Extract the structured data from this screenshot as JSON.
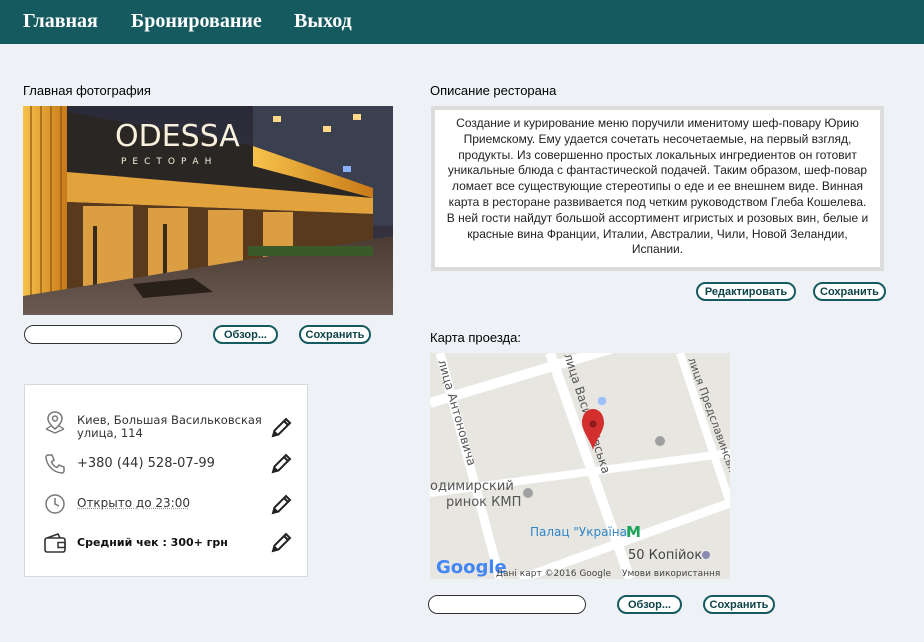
{
  "nav": {
    "home": "Главная",
    "booking": "Бронирование",
    "logout": "Выход"
  },
  "photo_section": {
    "label": "Главная фотография",
    "sign_name": "ODESSA",
    "sign_sub": "РЕСТОРАН",
    "browse_label": "Обзор...",
    "save_label": "Сохранить",
    "file_value": ""
  },
  "description_section": {
    "label": "Описание ресторана",
    "text": "Создание и курирование меню поручили именитому шеф-повару Юрию Приемскому. Ему удается сочетать несочетаемые, на первый взгляд, продукты. Из совершенно простых локальных ингредиентов он готовит уникальные блюда с фантастической подачей. Таким образом, шеф-повар ломает все существующие стереотипы о еде и ее внешнем виде. Винная карта в ресторане развивается под четким руководством Глеба Кошелева. В ней гости найдут большой ассортимент игристых и розовых вин, белые и красные вина Франции, Италии, Австралии, Чили, Новой Зеландии, Испании.",
    "edit_label": "Редактировать",
    "save_label": "Сохранить"
  },
  "info": {
    "address": "Киев, Большая Васильковская улица, 114",
    "phone": "+380 (44) 528-07-99",
    "hours": "Открыто до 23:00",
    "avg_check": "Средний чек : 300+ грн"
  },
  "map_section": {
    "label": "Карта проезда:",
    "street_1": "лица Антоновича",
    "street_2": "лица Васильківська",
    "street_3": "лиця Предславинська",
    "market": "одимирский\nринок КМП",
    "palace": "Палац \"Україна\"",
    "metro_letter": "M",
    "shop": "50 Копійок",
    "google": "Google",
    "map_data": "Дані карт ©2016 Google",
    "terms": "Умови використання",
    "browse_label": "Обзор...",
    "save_label": "Сохранить",
    "file_value": ""
  },
  "colors": {
    "header_bg": "#155a5f",
    "button_border": "#155a5f",
    "page_bg": "#eef2f6",
    "map_pin": "#d32f2f"
  }
}
